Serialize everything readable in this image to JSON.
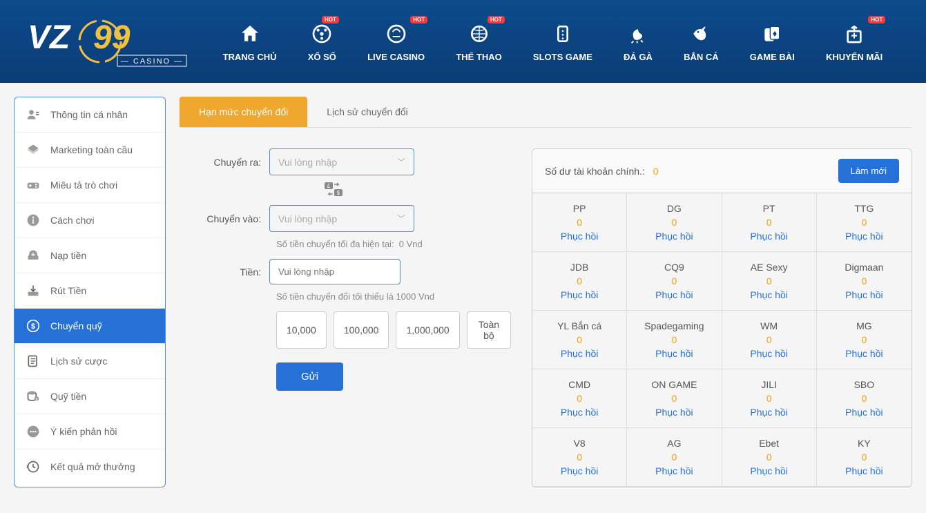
{
  "logo_text": "VZ99 CASINO",
  "hot_badge": "HOT",
  "nav": [
    {
      "label": "TRANG CHỦ",
      "hot": false
    },
    {
      "label": "XỔ SỐ",
      "hot": true
    },
    {
      "label": "LIVE CASINO",
      "hot": true
    },
    {
      "label": "THỂ THAO",
      "hot": true
    },
    {
      "label": "SLOTS GAME",
      "hot": false
    },
    {
      "label": "ĐÁ GÀ",
      "hot": false
    },
    {
      "label": "BẮN CÁ",
      "hot": false
    },
    {
      "label": "GAME BÀI",
      "hot": false
    },
    {
      "label": "KHUYẾN MÃI",
      "hot": true
    }
  ],
  "sidebar": {
    "items": [
      {
        "label": "Thông tin cá nhân"
      },
      {
        "label": "Marketing toàn cầu"
      },
      {
        "label": "Miêu tả trò chơi"
      },
      {
        "label": "Cách chơi"
      },
      {
        "label": "Nạp tiền"
      },
      {
        "label": "Rút Tiền"
      },
      {
        "label": "Chuyển quỹ"
      },
      {
        "label": "Lịch sử cược"
      },
      {
        "label": "Quỹ tiền"
      },
      {
        "label": "Ý kiến phản hồi"
      },
      {
        "label": "Kết quả mở thưởng"
      }
    ],
    "active_index": 6
  },
  "tabs": [
    {
      "label": "Hạn mức chuyển đổi",
      "active": true
    },
    {
      "label": "Lịch sử chuyển đổi",
      "active": false
    }
  ],
  "form": {
    "from_label": "Chuyển ra:",
    "to_label": "Chuyển vào:",
    "amount_label": "Tiền:",
    "placeholder": "Vui lòng nhập",
    "max_info_prefix": "Số tiền chuyển tối đa hiện tại:",
    "max_info_value": "0 Vnd",
    "min_info": "Số tiền chuyển đổi tối thiểu là 1000 Vnd",
    "amount_buttons": [
      "10,000",
      "100,000",
      "1,000,000",
      "Toàn bộ"
    ],
    "submit": "Gửi"
  },
  "balance": {
    "header_label": "Số dư tài khoản chính.:",
    "header_value": "0",
    "refresh": "Làm mới",
    "restore_label": "Phục hồi",
    "providers": [
      {
        "name": "PP",
        "value": "0"
      },
      {
        "name": "DG",
        "value": "0"
      },
      {
        "name": "PT",
        "value": "0"
      },
      {
        "name": "TTG",
        "value": "0"
      },
      {
        "name": "JDB",
        "value": "0"
      },
      {
        "name": "CQ9",
        "value": "0"
      },
      {
        "name": "AE Sexy",
        "value": "0"
      },
      {
        "name": "Digmaan",
        "value": "0"
      },
      {
        "name": "YL Bắn cá",
        "value": "0"
      },
      {
        "name": "Spadegaming",
        "value": "0"
      },
      {
        "name": "WM",
        "value": "0"
      },
      {
        "name": "MG",
        "value": "0"
      },
      {
        "name": "CMD",
        "value": "0"
      },
      {
        "name": "ON GAME",
        "value": "0"
      },
      {
        "name": "JILI",
        "value": "0"
      },
      {
        "name": "SBO",
        "value": "0"
      },
      {
        "name": "V8",
        "value": "0"
      },
      {
        "name": "AG",
        "value": "0"
      },
      {
        "name": "Ebet",
        "value": "0"
      },
      {
        "name": "KY",
        "value": "0"
      }
    ]
  }
}
